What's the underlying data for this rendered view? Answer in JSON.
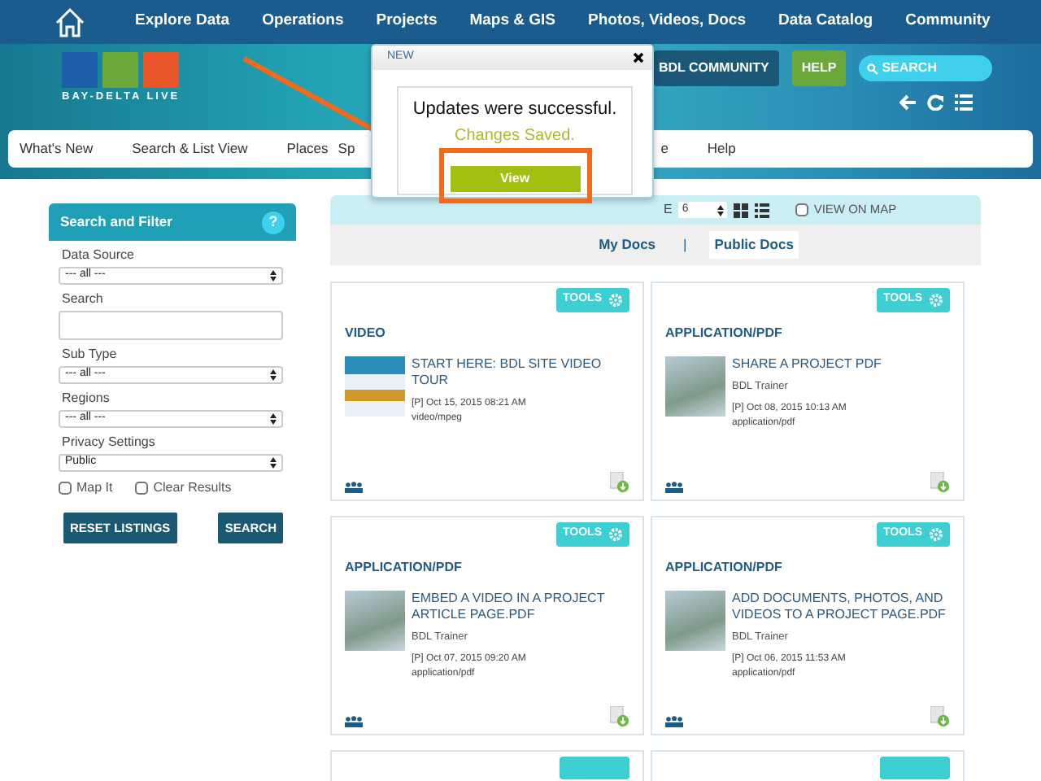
{
  "top_nav": {
    "items": [
      "Explore Data",
      "Operations",
      "Projects",
      "Maps & GIS",
      "Photos, Videos, Docs",
      "Data Catalog",
      "Community"
    ]
  },
  "header": {
    "logo_text": "BAY-DELTA LIVE",
    "buttons": [
      {
        "label": "BDL COMMUNITY",
        "kind": "community"
      },
      {
        "label": "HELP",
        "kind": "help"
      }
    ],
    "search": {
      "placeholder": "SEARCH"
    }
  },
  "main_nav": {
    "items": [
      "What's New",
      "Search & List View",
      "Places",
      "Sp",
      "e",
      "Help"
    ]
  },
  "modal": {
    "title": "NEW",
    "message": "Updates were successful.",
    "status": "Changes Saved.",
    "button": "View"
  },
  "sidebar": {
    "title": "Search and Filter",
    "help": "?",
    "fields": [
      {
        "label": "Data Source",
        "kind": "select",
        "value": "--- all ---"
      },
      {
        "label": "Search",
        "kind": "text"
      },
      {
        "label": "Sub Type",
        "kind": "select",
        "value": "--- all ---"
      },
      {
        "label": "Regions",
        "kind": "select",
        "value": "--- all ---"
      },
      {
        "label": "Privacy Settings",
        "kind": "select",
        "value": "Public"
      }
    ],
    "checkboxes": [
      {
        "label": "Map It",
        "checked": false
      },
      {
        "label": "Clear Results",
        "checked": false
      }
    ],
    "buttons": [
      "RESET LISTINGS",
      "SEARCH"
    ]
  },
  "toolbar": {
    "cut_label": "E",
    "per_page": "6",
    "view_on_map": {
      "label": "VIEW ON MAP",
      "checked": false
    }
  },
  "doc_tabs": [
    {
      "label": "My Docs",
      "selected": false
    },
    {
      "label": "Public Docs",
      "selected": true
    }
  ],
  "doc_tab_separator": "|",
  "cards": [
    {
      "tools": "TOOLS",
      "type": "VIDEO",
      "kind": "video",
      "title": "START HERE: BDL SITE VIDEO TOUR",
      "date": "[P] Oct 15, 2015 08:21 AM",
      "mime": "video/mpeg"
    },
    {
      "tools": "TOOLS",
      "type": "APPLICATION/PDF",
      "kind": "photo",
      "title": "SHARE A PROJECT PDF",
      "author": "BDL Trainer",
      "date": "[P] Oct 08, 2015 10:13 AM",
      "mime": "application/pdf"
    },
    {
      "tools": "TOOLS",
      "type": "APPLICATION/PDF",
      "kind": "photo",
      "title": "EMBED A VIDEO IN A PROJECT ARTICLE PAGE.PDF",
      "author": "BDL Trainer",
      "date": "[P] Oct 07, 2015 09:20 AM",
      "mime": "application/pdf"
    },
    {
      "tools": "TOOLS",
      "type": "APPLICATION/PDF",
      "kind": "photo",
      "title": "ADD DOCUMENTS, PHOTOS, AND VIDEOS TO A PROJECT PAGE.PDF",
      "author": "BDL Trainer",
      "date": "[P] Oct 06, 2015 11:53 AM",
      "mime": "application/pdf"
    }
  ],
  "cut_cards": [
    {
      "kind": "cut"
    },
    {
      "kind": "cut"
    }
  ]
}
